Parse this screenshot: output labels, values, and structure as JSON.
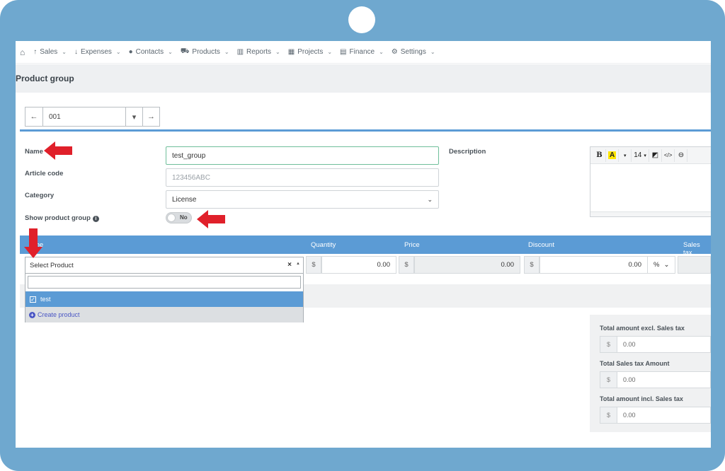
{
  "nav": {
    "items": [
      {
        "icon": "↑",
        "label": "Sales"
      },
      {
        "icon": "↓",
        "label": "Expenses"
      },
      {
        "icon": "●",
        "label": "Contacts"
      },
      {
        "icon": "⛟",
        "label": "Products"
      },
      {
        "icon": "▥",
        "label": "Reports"
      },
      {
        "icon": "▦",
        "label": "Projects"
      },
      {
        "icon": "▤",
        "label": "Finance"
      },
      {
        "icon": "⚙",
        "label": "Settings"
      }
    ]
  },
  "page": {
    "title": "Product group"
  },
  "record": {
    "number": "001"
  },
  "form": {
    "name_label": "Name",
    "name_value": "test_group",
    "article_label": "Article code",
    "article_placeholder": "123456ABC",
    "category_label": "Category",
    "category_value": "License",
    "show_label": "Show product group",
    "show_toggle_text": "No",
    "description_label": "Description"
  },
  "editor": {
    "bold": "B",
    "highlight": "A",
    "font_size": "14"
  },
  "table": {
    "headers": {
      "name": "me",
      "quantity": "Quantity",
      "price": "Price",
      "discount": "Discount",
      "sales_tax": "Sales tax"
    },
    "row": {
      "currency": "$",
      "quantity": "0.00",
      "price": "0.00",
      "discount": "0.00",
      "discount_unit": "%"
    }
  },
  "product_select": {
    "placeholder": "Select Product",
    "clear": "×",
    "options": [
      {
        "label": "test",
        "selected": true
      }
    ],
    "create_label": "Create product"
  },
  "totals": {
    "currency": "$",
    "excl_label": "Total amount excl. Sales tax",
    "excl_value": "0.00",
    "tax_label": "Total Sales tax Amount",
    "tax_value": "0.00",
    "incl_label": "Total amount incl. Sales tax",
    "incl_value": "0.00"
  },
  "colors": {
    "frame": "#6fa8cf",
    "accent_blue": "#5b9bd5",
    "arrow_red": "#e0202a",
    "link": "#4a56c4"
  }
}
